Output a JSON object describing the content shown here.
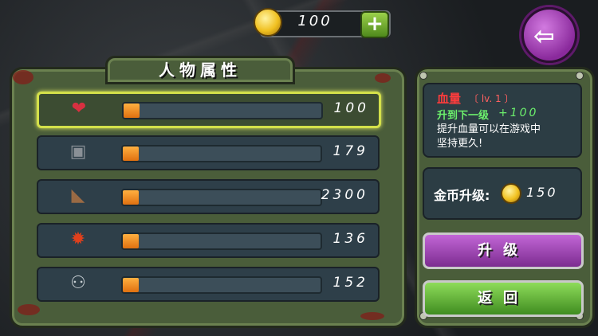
{
  "top_bar": {
    "coins": "100",
    "add_coins_symbol": "+",
    "back_arrow": "⇦"
  },
  "panel_title": "人物属性",
  "attributes": [
    {
      "icon": "heart-icon",
      "value": "100",
      "progress": 0.08,
      "selected": true
    },
    {
      "icon": "armor-vest-icon",
      "value": "179",
      "progress": 0.08
    },
    {
      "icon": "boot-icon",
      "value": "2300",
      "progress": 0.08
    },
    {
      "icon": "explosion-icon",
      "value": "136",
      "progress": 0.08
    },
    {
      "icon": "sunglasses-icon",
      "value": "152",
      "progress": 0.08
    }
  ],
  "detail": {
    "name": "血量",
    "level": "〔 lv. 1 〕",
    "next_label": "升到下一级",
    "next_value": "+100",
    "description": "提升血量可以在游戏中坚持更久!"
  },
  "cost": {
    "label": "金币升级:",
    "value": "150"
  },
  "buttons": {
    "upgrade": "升级",
    "return": "返回"
  },
  "colors": {
    "accent_selected": "#d4e04a",
    "bar_fill": "#f08a20",
    "upgrade_btn": "#a040b8",
    "return_btn": "#5cb030"
  }
}
